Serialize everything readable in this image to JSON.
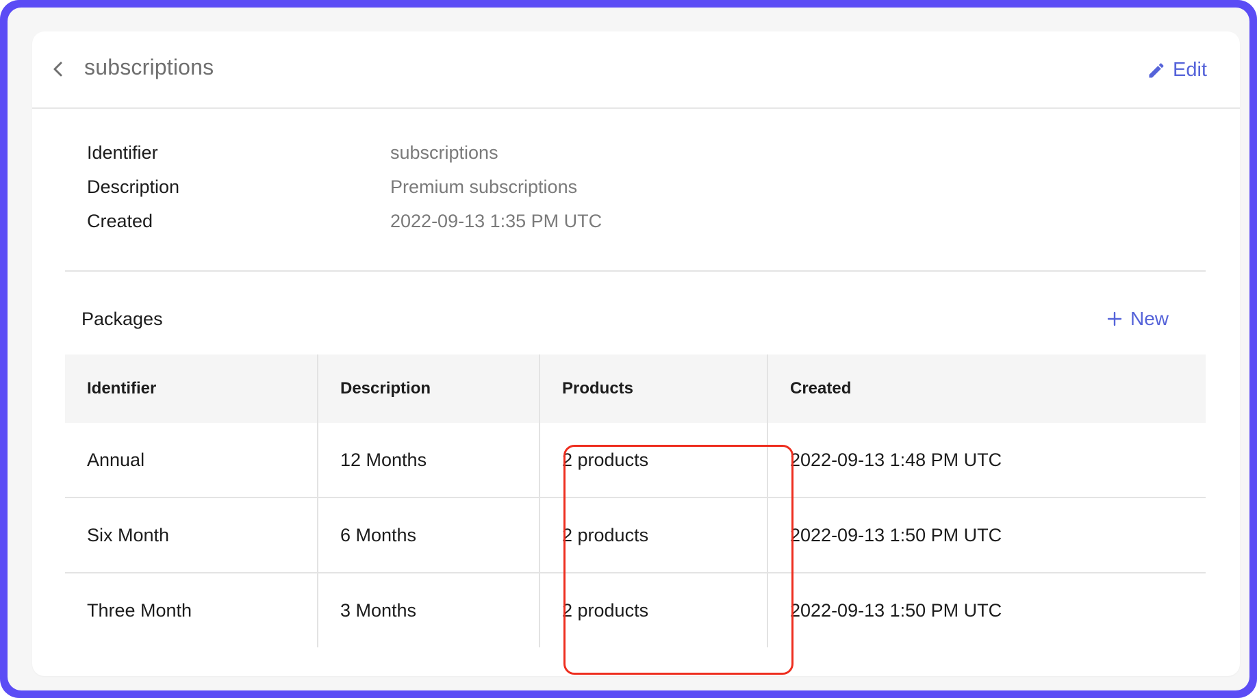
{
  "header": {
    "title": "subscriptions",
    "edit_label": "Edit"
  },
  "details": [
    {
      "label": "Identifier",
      "value": "subscriptions"
    },
    {
      "label": "Description",
      "value": "Premium subscriptions"
    },
    {
      "label": "Created",
      "value": "2022-09-13 1:35 PM UTC"
    }
  ],
  "packages": {
    "title": "Packages",
    "new_label": "New",
    "columns": [
      "Identifier",
      "Description",
      "Products",
      "Created"
    ],
    "rows": [
      {
        "identifier": "Annual",
        "description": "12 Months",
        "products": "2 products",
        "created": "2022-09-13 1:48 PM UTC"
      },
      {
        "identifier": "Six Month",
        "description": "6 Months",
        "products": "2 products",
        "created": "2022-09-13 1:50 PM UTC"
      },
      {
        "identifier": "Three Month",
        "description": "3 Months",
        "products": "2 products",
        "created": "2022-09-13 1:50 PM UTC"
      }
    ]
  },
  "colors": {
    "frame": "#5b4cf5",
    "accent": "#5563d9",
    "highlight": "#ee2e1f"
  },
  "icons": {
    "back": "chevron-left-icon",
    "edit": "pencil-icon",
    "new": "plus-icon"
  }
}
